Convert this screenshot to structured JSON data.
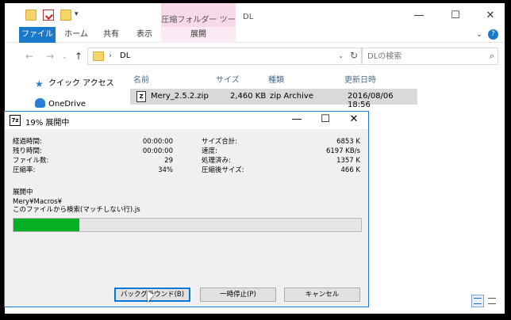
{
  "explorer": {
    "context_tab_group": "圧縮フォルダー ツール",
    "title": "DL",
    "ribbon_tabs": [
      {
        "label": "ファイル"
      },
      {
        "label": "ホーム"
      },
      {
        "label": "共有"
      },
      {
        "label": "表示"
      },
      {
        "label": "展開"
      }
    ],
    "address": {
      "crumb": "DL"
    },
    "search": {
      "placeholder": "DLの検索"
    },
    "nav_items": [
      {
        "label": "クイック アクセス",
        "icon": "star-icon"
      },
      {
        "label": "OneDrive",
        "icon": "cloud-icon"
      }
    ],
    "columns": {
      "name": "名前",
      "size": "サイズ",
      "type": "種類",
      "modified": "更新日時"
    },
    "files": [
      {
        "name": "Mery_2.5.2.zip",
        "size": "2,460 KB",
        "type": "zip Archive",
        "modified": "2016/08/06 18:56"
      }
    ]
  },
  "dialog": {
    "title": "19% 展開中",
    "icon_text": "7z",
    "progress_percent": 19,
    "stats_left": [
      {
        "label": "経過時間:",
        "value": "00:00:00"
      },
      {
        "label": "残り時間:",
        "value": "00:00:00"
      },
      {
        "label": "ファイル数:",
        "value": "29"
      },
      {
        "label": "圧縮率:",
        "value": "34%"
      }
    ],
    "stats_right": [
      {
        "label": "サイズ合計:",
        "value": "6853 K"
      },
      {
        "label": "速度:",
        "value": "6197 KB/s"
      },
      {
        "label": "処理済み:",
        "value": "1357 K"
      },
      {
        "label": "圧縮後サイズ:",
        "value": "466 K"
      }
    ],
    "status_heading": "展開中",
    "current_path": "Mery¥Macros¥",
    "current_file": "このファイルから検索(マッチしない行).js",
    "buttons": {
      "background": "バックグラウンド(B)",
      "pause": "一時停止(P)",
      "cancel": "キャンセル"
    }
  },
  "colors": {
    "accent": "#1979ca",
    "progress": "#06b025",
    "context_tab": "#f8d9ea"
  }
}
